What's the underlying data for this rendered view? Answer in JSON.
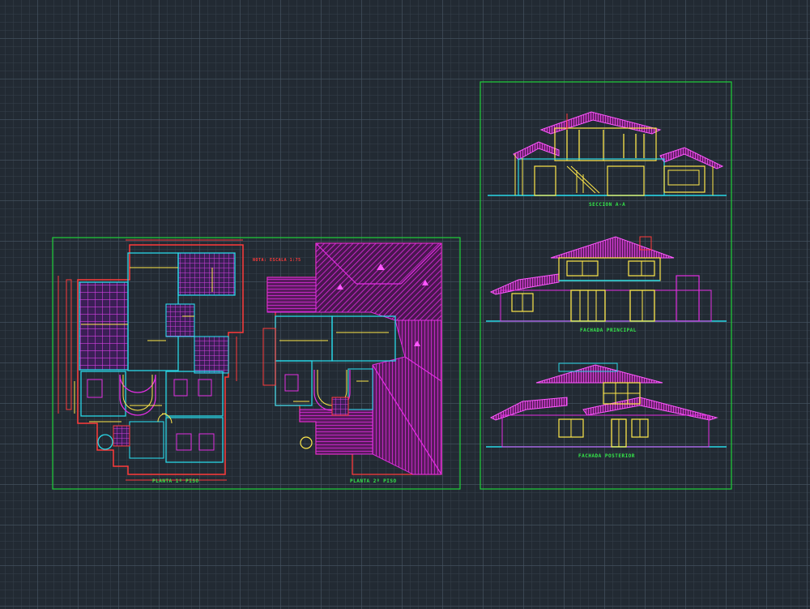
{
  "drawing": {
    "sheet_plans_labels": {
      "first_floor": "PLANTA 1º PISO",
      "second_floor": "PLANTA 2º PISO",
      "house_title": "NOTA: ESCALA 1:75"
    },
    "sheet_elevations_labels": {
      "section": "SECCION A-A",
      "main_facade": "FACHADA PRINCIPAL",
      "rear_facade": "FACHADA POSTERIOR"
    }
  },
  "colors": {
    "background": "#222a33",
    "frame": "#1fd13a",
    "wall": "#ff3b3b",
    "roof": "#e22ee2",
    "detail": "#ffe84a",
    "accent": "#29d7e6",
    "label": "#35e84a"
  }
}
